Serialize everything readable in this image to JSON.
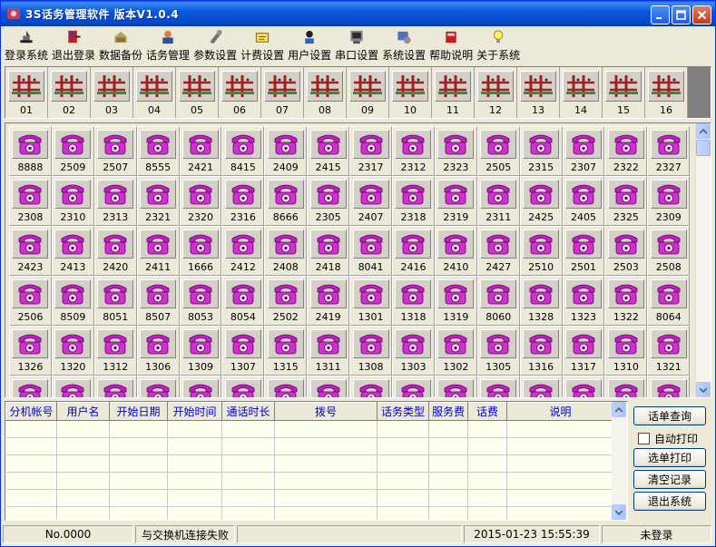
{
  "window": {
    "title": "3S话务管理软件 版本V1.0.4"
  },
  "toolbar": [
    {
      "label": "登录系统",
      "icon": "login-icon"
    },
    {
      "label": "退出登录",
      "icon": "logout-icon"
    },
    {
      "label": "数据备份",
      "icon": "backup-icon"
    },
    {
      "label": "话务管理",
      "icon": "call-management-icon"
    },
    {
      "label": "参数设置",
      "icon": "parameter-settings-icon"
    },
    {
      "label": "计费设置",
      "icon": "billing-settings-icon"
    },
    {
      "label": "用户设置",
      "icon": "user-settings-icon"
    },
    {
      "label": "串口设置",
      "icon": "serial-port-icon"
    },
    {
      "label": "系统设置",
      "icon": "system-settings-icon"
    },
    {
      "label": "帮助说明",
      "icon": "help-book-icon"
    },
    {
      "label": "关于系统",
      "icon": "about-bulb-icon"
    }
  ],
  "trunks": [
    "01",
    "02",
    "03",
    "04",
    "05",
    "06",
    "07",
    "08",
    "09",
    "10",
    "11",
    "12",
    "13",
    "14",
    "15",
    "16"
  ],
  "extensions": [
    "8888",
    "2509",
    "2507",
    "8555",
    "2421",
    "8415",
    "2409",
    "2415",
    "2317",
    "2312",
    "2323",
    "2505",
    "2315",
    "2307",
    "2322",
    "2327",
    "2308",
    "2310",
    "2313",
    "2321",
    "2320",
    "2316",
    "8666",
    "2305",
    "2407",
    "2318",
    "2319",
    "2311",
    "2425",
    "2405",
    "2325",
    "2309",
    "2423",
    "2413",
    "2420",
    "2411",
    "1666",
    "2412",
    "2408",
    "2418",
    "8041",
    "2416",
    "2410",
    "2427",
    "2510",
    "2501",
    "2503",
    "2508",
    "2506",
    "8509",
    "8051",
    "8507",
    "8053",
    "8054",
    "2502",
    "2419",
    "1301",
    "1318",
    "1319",
    "8060",
    "1328",
    "1323",
    "1322",
    "8064",
    "1326",
    "1320",
    "1312",
    "1306",
    "1309",
    "1307",
    "1315",
    "1311",
    "1308",
    "1303",
    "1302",
    "1305",
    "1316",
    "1317",
    "1310",
    "1321",
    "",
    "",
    "",
    "",
    "",
    "",
    "",
    "",
    "",
    "",
    "",
    "",
    "",
    "",
    "",
    ""
  ],
  "log_columns": [
    "分机帐号",
    "用户名",
    "开始日期",
    "开始时间",
    "通话时长",
    "拨号",
    "话务类型",
    "服务费",
    "话费",
    "说明"
  ],
  "buttons": {
    "query": "话单查询",
    "auto_print": "自动打印",
    "print_selected": "选单打印",
    "clear_records": "清空记录",
    "exit": "退出系统"
  },
  "status": {
    "number": "No.0000",
    "connection": "与交换机连接失败",
    "datetime": "2015-01-23 15:55:39",
    "login": "未登录"
  }
}
